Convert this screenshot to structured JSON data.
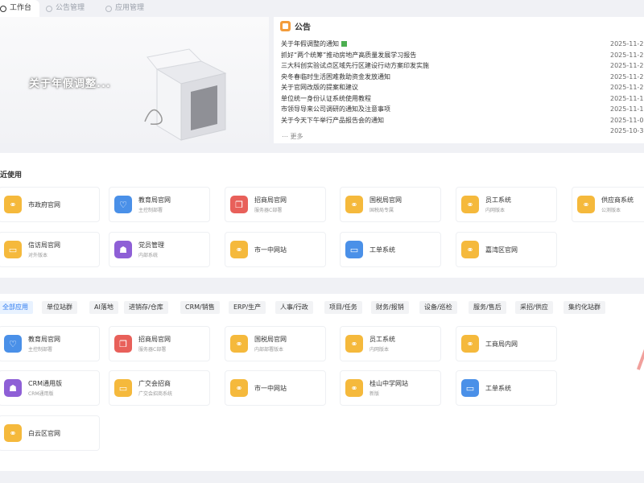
{
  "tabs": [
    {
      "label": "工作台",
      "active": true
    },
    {
      "label": "公告管理",
      "active": false
    },
    {
      "label": "应用管理",
      "active": false
    }
  ],
  "banner": {
    "text": "关于年假调整..."
  },
  "notice": {
    "title": "公告",
    "items": [
      {
        "title": "关于年假调整的通知",
        "date": "2025-11-2",
        "new": true
      },
      {
        "title": "抓好“两个统筹”推动房地产高质量发展学习报告",
        "date": "2025-11-2"
      },
      {
        "title": "三大科创实验试点区域先行区建设行动方案印发实施",
        "date": "2025-11-2"
      },
      {
        "title": "央冬春临时生活困难救助资金发放通知",
        "date": "2025-11-2"
      },
      {
        "title": "关于官网改版的提案和建议",
        "date": "2025-11-2"
      },
      {
        "title": "单位统一身份认证系统使用教程",
        "date": "2025-11-1"
      },
      {
        "title": "市领导导来公司调研的通知及注意事项",
        "date": "2025-11-1"
      },
      {
        "title": "关于今天下午举行产品报告会的通知",
        "date": "2025-11-0"
      },
      {
        "title": "",
        "date": "2025-10-3"
      }
    ],
    "more": "更多"
  },
  "recent": {
    "title": "近使用",
    "apps": [
      {
        "name": "市政府官网",
        "sub": "",
        "color": "yellow",
        "icon": "link-icon"
      },
      {
        "name": "教育局官网",
        "sub": "主控制部署",
        "color": "blue",
        "icon": "heart-icon"
      },
      {
        "name": "招商局官网",
        "sub": "服务器C部署",
        "color": "red",
        "icon": "window-icon"
      },
      {
        "name": "国税局官网",
        "sub": "国税局专属",
        "color": "yellow",
        "icon": "link-icon"
      },
      {
        "name": "员工系统",
        "sub": "内网版本",
        "color": "yellow",
        "icon": "link-icon"
      },
      {
        "name": "供应商系统",
        "sub": "公测版本",
        "color": "yellow",
        "icon": "link-icon"
      },
      {
        "name": "信访局官网",
        "sub": "对外版本",
        "color": "yellow",
        "icon": "monitor-icon"
      },
      {
        "name": "党员管理",
        "sub": "内部系统",
        "color": "purple",
        "icon": "user-icon"
      },
      {
        "name": "市一中网站",
        "sub": "",
        "color": "yellow",
        "icon": "link-icon"
      },
      {
        "name": "工单系统",
        "sub": "",
        "color": "blue",
        "icon": "monitor-icon"
      },
      {
        "name": "嘉湾区官网",
        "sub": "",
        "color": "yellow",
        "icon": "link-icon"
      }
    ]
  },
  "filters": [
    "全部应用",
    "单位站群",
    "AI落地",
    "进销存/仓库",
    "CRM/销售",
    "ERP/生产",
    "人事/行政",
    "项目/任务",
    "财务/报销",
    "设备/巡检",
    "服务/售后",
    "采招/供应",
    "集约化站群"
  ],
  "all_apps": [
    {
      "name": "教育局官网",
      "sub": "主控制部署",
      "color": "blue",
      "icon": "heart-icon"
    },
    {
      "name": "招商局官网",
      "sub": "服务器C部署",
      "color": "red",
      "icon": "window-icon"
    },
    {
      "name": "国税局官网",
      "sub": "内部部署版本",
      "color": "yellow",
      "icon": "link-icon"
    },
    {
      "name": "员工系统",
      "sub": "内网版本",
      "color": "yellow",
      "icon": "link-icon"
    },
    {
      "name": "工商局内网",
      "sub": "",
      "color": "yellow",
      "icon": "link-icon"
    },
    {
      "name": "CRM通用版",
      "sub": "CRM通用版",
      "color": "purple",
      "icon": "user-icon"
    },
    {
      "name": "广交会招商",
      "sub": "广交会招商系统",
      "color": "yellow",
      "icon": "monitor-icon"
    },
    {
      "name": "市一中网站",
      "sub": "",
      "color": "yellow",
      "icon": "link-icon"
    },
    {
      "name": "桂山中学网站",
      "sub": "新版",
      "color": "yellow",
      "icon": "link-icon"
    },
    {
      "name": "工单系统",
      "sub": "",
      "color": "blue",
      "icon": "monitor-icon"
    },
    {
      "name": "白云区官网",
      "sub": "",
      "color": "yellow",
      "icon": "link-icon"
    }
  ]
}
